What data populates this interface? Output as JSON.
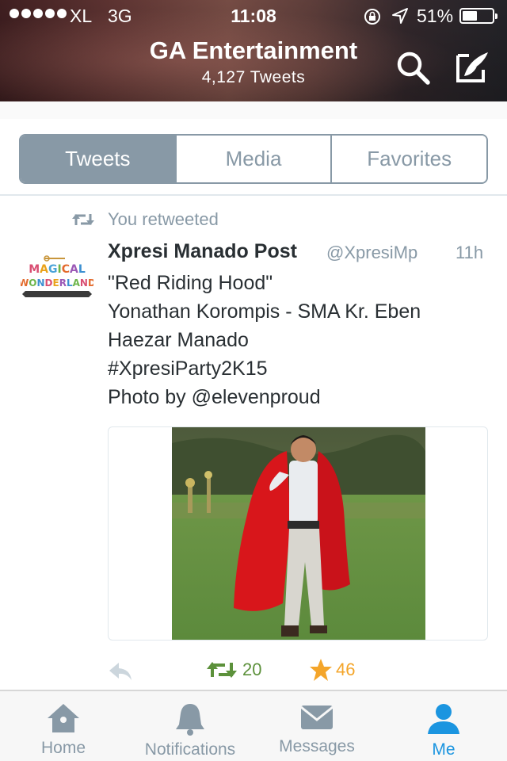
{
  "status_bar": {
    "carrier": "XL",
    "network": "3G",
    "time": "11:08",
    "battery_percent": "51%",
    "battery_level": 0.51
  },
  "header": {
    "title": "GA Entertainment",
    "subtitle": "4,127 Tweets",
    "icons": [
      "search-icon",
      "compose-icon"
    ]
  },
  "segments": {
    "items": [
      "Tweets",
      "Media",
      "Favorites"
    ],
    "active": "Tweets"
  },
  "tweet": {
    "retweet_label": "You retweeted",
    "author_name": "Xpresi Manado Post",
    "author_handle": "@XpresiMp",
    "time": "11h",
    "lines": [
      "\"Red Riding Hood\"",
      "Yonathan Korompis - SMA Kr. Eben",
      "Haezar Manado",
      "#XpresiParty2K15",
      "Photo by @elevenproud"
    ],
    "avatar_text": "Magical Wonderland",
    "retweet_count": "20",
    "favorite_count": "46"
  },
  "tabbar": {
    "items": [
      {
        "label": "Home",
        "icon": "home-icon"
      },
      {
        "label": "Notifications",
        "icon": "bell-icon"
      },
      {
        "label": "Messages",
        "icon": "envelope-icon"
      },
      {
        "label": "Me",
        "icon": "person-icon"
      }
    ],
    "active": "Me"
  },
  "colors": {
    "accent": "#1b95e0",
    "muted": "#8899a6",
    "retweet_green": "#5c913b",
    "favorite_orange": "#f4a52a"
  }
}
